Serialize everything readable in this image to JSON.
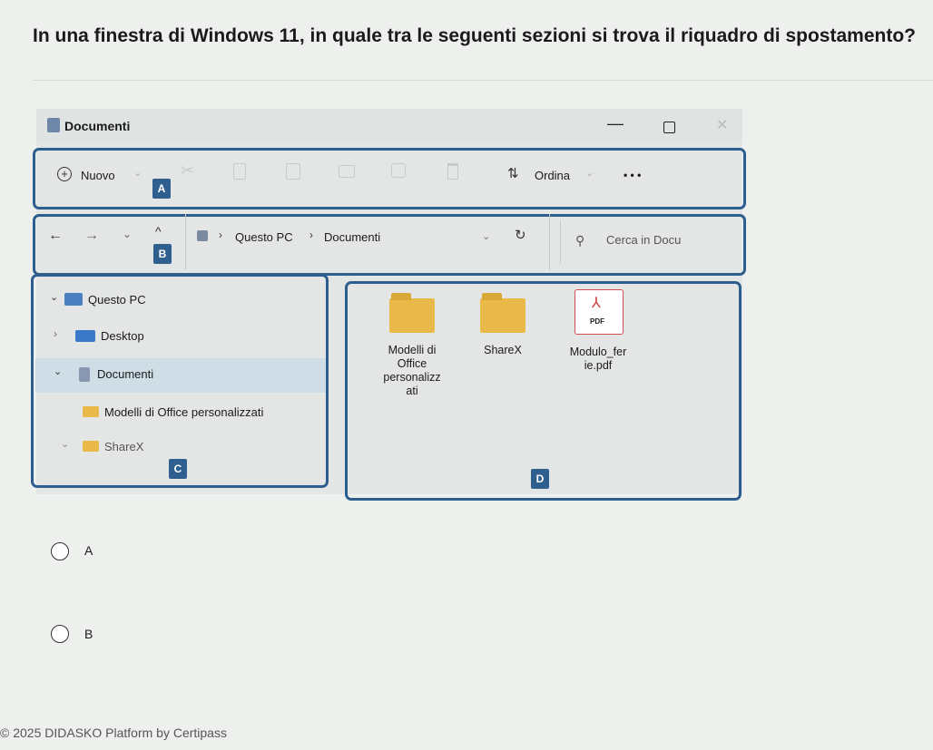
{
  "question": "In una finestra di Windows 11, in quale tra le seguenti sezioni si trova il riquadro di spostamento?",
  "window": {
    "title": "Documenti",
    "minimize_glyph": "—",
    "close_glyph": "✕"
  },
  "toolbar": {
    "new_label": "Nuovo",
    "sort_label": "Ordina",
    "more_label": "• • •"
  },
  "address": {
    "crumb1": "Questo PC",
    "crumb2": "Documenti",
    "search_placeholder": "Cerca in Docu"
  },
  "nav": {
    "items": [
      {
        "label": "Questo PC"
      },
      {
        "label": "Desktop"
      },
      {
        "label": "Documenti"
      },
      {
        "label": "Modelli di Office personalizzati"
      },
      {
        "label": "ShareX"
      }
    ]
  },
  "content": {
    "items": [
      {
        "label": "Modelli di\nOffice\npersonalizz\nati",
        "type": "folder"
      },
      {
        "label": "ShareX",
        "type": "folder"
      },
      {
        "label": "Modulo_fer\nie.pdf",
        "type": "pdf",
        "badge": "PDF"
      }
    ]
  },
  "labels": {
    "a": "A",
    "b": "B",
    "c": "C",
    "d": "D"
  },
  "options": [
    {
      "label": "A"
    },
    {
      "label": "B"
    }
  ],
  "footer": "© 2025  DIDASKO Platform by Certipass",
  "colors": {
    "highlight_border": "#2d5e8e",
    "label_bg": "#2f5f8f",
    "folder": "#e9b949"
  }
}
